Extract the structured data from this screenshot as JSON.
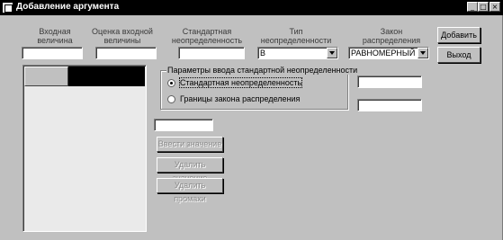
{
  "window": {
    "title": "Добавление аргумента"
  },
  "titlebar_buttons": {
    "minimize": "_",
    "maximize": "□",
    "close": "×"
  },
  "headers": {
    "input_quantity": "Входная величина",
    "input_estimate": "Оценка входной величины",
    "std_uncertainty": "Стандартная неопределенность",
    "uncertainty_type": "Тип неопределенности",
    "distribution_law": "Закон распределения"
  },
  "fields": {
    "input_quantity_value": "",
    "input_estimate_value": "",
    "std_uncertainty_value": "",
    "uncertainty_type_selected": "В",
    "distribution_law_selected": "РАВНОМЕРНЫЙ",
    "param_value_1": "",
    "param_value_2": "",
    "value_entry": ""
  },
  "buttons": {
    "add": "Добавить",
    "exit": "Выход",
    "enter_value": "Ввести значение",
    "delete_value": "Удалить значение",
    "delete_blanks": "Удалить промахи"
  },
  "groupbox": {
    "title": "Параметры ввода стандартной неопределенности",
    "option_std": "Стандартная неопределенность",
    "option_bounds": "Границы закона распределения",
    "selected": "option_std"
  }
}
